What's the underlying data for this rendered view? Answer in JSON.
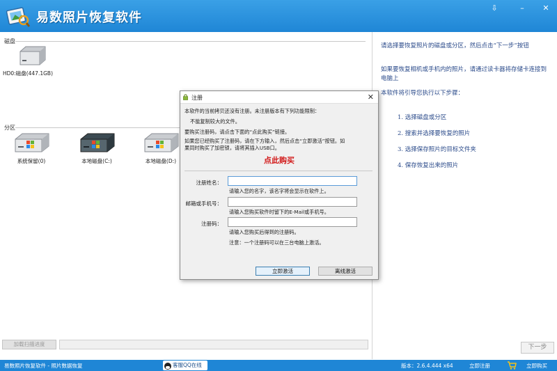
{
  "app": {
    "title": "易数照片恢复软件"
  },
  "window_controls": {
    "menu": "⇩",
    "minimize": "–",
    "close": "✕"
  },
  "left": {
    "disk_section_label": "磁盘",
    "disks": [
      {
        "label": "HD0:磁盘(447.1GB)",
        "icon": "hard-drive-icon"
      }
    ],
    "partition_section_label": "分区",
    "partitions": [
      {
        "label": "系统保留(0)",
        "icon": "partition-drive-icon"
      },
      {
        "label": "本地磁盘(C:)",
        "icon": "windows-drive-icon"
      },
      {
        "label": "本地磁盘(D:)",
        "icon": "partition-drive-icon"
      }
    ]
  },
  "guide": {
    "p1": "请选择要恢复照片的磁盘或分区，然后点击“下一步”按钮",
    "p2": "如果要恢复相机或手机内的照片，请通过读卡器将存储卡连接到电脑上",
    "p3": "本软件将引导您执行以下步骤：",
    "steps": [
      "1. 选择磁盘或分区",
      "2. 搜索并选择要恢复的照片",
      "3. 选择保存照片的目标文件夹",
      "4. 保存恢复出来的照片"
    ]
  },
  "bottom": {
    "load_button": "加载扫描进度",
    "next_button": "下一步"
  },
  "statusbar": {
    "left_text": "易数照片恢复软件 - 照片数据恢复",
    "qq_button": "客服QQ在线",
    "version": "版本：2.6.4.444 x64",
    "register_link": "立即注册",
    "buy_link": "立即购买"
  },
  "dialog": {
    "title": "注册",
    "close": "✕",
    "line1": "本软件的当前拷贝还没有注册。未注册版本有下列功能限制：",
    "line2": "不能复制较大的文件。",
    "line3": "要购买注册码，请点击下面的“点此购买”链接。",
    "line4": "如果您已经购买了注册码，请在下方输入，然后点击“立即激活”按钮。如",
    "line5": "果同时购买了加密锁，请将其插入USB口。",
    "buy_link": "点此购买",
    "name_label": "注册姓名：",
    "name_value": "",
    "name_hint": "请输入您的名字，该名字将会显示在软件上。",
    "email_label": "邮箱或手机号：",
    "email_value": "",
    "email_hint": "请输入您购买软件时留下的E-Mail或手机号。",
    "code_label": "注册码：",
    "code_value": "",
    "code_hint": "请输入您购买后得到的注册码。",
    "note": "注意：一个注册码可以在三台电脑上激活。",
    "activate_button": "立即激活",
    "offline_button": "离线激活"
  },
  "colors": {
    "titlebar": "#1f86d6",
    "buy_red": "#d21a1a",
    "guide_text": "#2a4a8a"
  }
}
